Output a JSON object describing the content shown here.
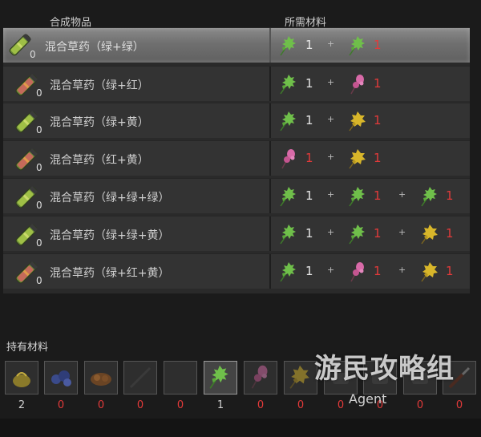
{
  "header": {
    "item_col": "合成物品",
    "materials_col": "所需材料"
  },
  "recipes": [
    {
      "name": "混合草药（绿+绿）",
      "count": "0",
      "tube": "green",
      "selected": true,
      "materials": [
        {
          "herb": "green",
          "qty": "1",
          "red": false
        },
        {
          "herb": "green",
          "qty": "1",
          "red": true
        }
      ]
    },
    {
      "name": "混合草药（绿+红）",
      "count": "0",
      "tube": "red",
      "selected": false,
      "materials": [
        {
          "herb": "green",
          "qty": "1",
          "red": false
        },
        {
          "herb": "red",
          "qty": "1",
          "red": true
        }
      ]
    },
    {
      "name": "混合草药（绿+黄）",
      "count": "0",
      "tube": "green",
      "selected": false,
      "materials": [
        {
          "herb": "green",
          "qty": "1",
          "red": false
        },
        {
          "herb": "yellow",
          "qty": "1",
          "red": true
        }
      ]
    },
    {
      "name": "混合草药（红+黄）",
      "count": "0",
      "tube": "red",
      "selected": false,
      "materials": [
        {
          "herb": "red",
          "qty": "1",
          "red": true
        },
        {
          "herb": "yellow",
          "qty": "1",
          "red": true
        }
      ]
    },
    {
      "name": "混合草药（绿+绿+绿）",
      "count": "0",
      "tube": "green",
      "selected": false,
      "materials": [
        {
          "herb": "green",
          "qty": "1",
          "red": false
        },
        {
          "herb": "green",
          "qty": "1",
          "red": true
        },
        {
          "herb": "green",
          "qty": "1",
          "red": true
        }
      ]
    },
    {
      "name": "混合草药（绿+绿+黄）",
      "count": "0",
      "tube": "green",
      "selected": false,
      "materials": [
        {
          "herb": "green",
          "qty": "1",
          "red": false
        },
        {
          "herb": "green",
          "qty": "1",
          "red": true
        },
        {
          "herb": "yellow",
          "qty": "1",
          "red": true
        }
      ]
    },
    {
      "name": "混合草药（绿+红+黄）",
      "count": "0",
      "tube": "red",
      "selected": false,
      "materials": [
        {
          "herb": "green",
          "qty": "1",
          "red": false
        },
        {
          "herb": "red",
          "qty": "1",
          "red": true
        },
        {
          "herb": "yellow",
          "qty": "1",
          "red": true
        }
      ]
    }
  ],
  "plus_sign": "+",
  "owned": {
    "title": "持有材料",
    "slots": [
      {
        "icon": "gunpowder-icon",
        "count": "2",
        "red": false,
        "active": false
      },
      {
        "icon": "blue-crystals-icon",
        "count": "0",
        "red": true,
        "active": false
      },
      {
        "icon": "brown-crystals-icon",
        "count": "0",
        "red": true,
        "active": false
      },
      {
        "icon": "rod-icon",
        "count": "0",
        "red": true,
        "active": false
      },
      {
        "icon": "blade-icon",
        "count": "0",
        "red": true,
        "active": false
      },
      {
        "icon": "green-herb-icon",
        "count": "1",
        "red": false,
        "active": true
      },
      {
        "icon": "red-herb-icon",
        "count": "0",
        "red": true,
        "active": false
      },
      {
        "icon": "yellow-herb-icon",
        "count": "0",
        "red": true,
        "active": false
      },
      {
        "icon": "unknown-material-icon",
        "count": "0",
        "red": true,
        "active": false
      },
      {
        "icon": "unknown-material-icon",
        "count": "0",
        "red": true,
        "active": false
      },
      {
        "icon": "unknown-material-icon",
        "count": "0",
        "red": true,
        "active": false
      },
      {
        "icon": "knife-icon",
        "count": "0",
        "red": true,
        "active": false
      }
    ]
  },
  "watermark": {
    "brand": "游民攻略组",
    "sub": "Agent"
  },
  "colors": {
    "red_count": "#e33a3a",
    "green_herb": "#6fbf4a",
    "red_herb": "#d86aa8",
    "yellow_herb": "#d8b62a"
  }
}
